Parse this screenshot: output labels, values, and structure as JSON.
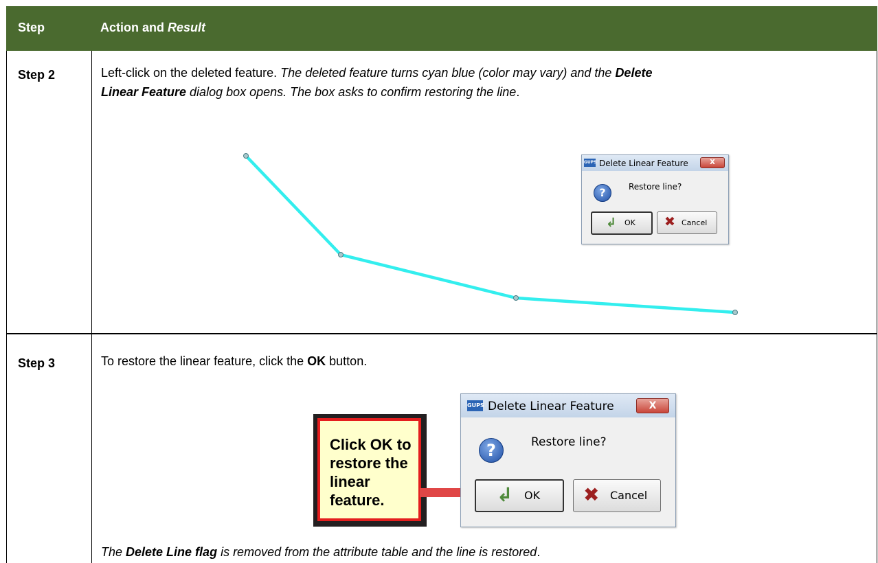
{
  "header": {
    "step": "Step",
    "action": "Action and ",
    "result": "Result"
  },
  "row1": {
    "step": "Step 2",
    "line1_plain": "Left-click on the deleted feature. ",
    "line1_it": "The deleted feature turns cyan blue (color may vary) and the ",
    "line1_bold": "Delete",
    "line2_bold": "Linear Feature",
    "line2_it": " dialog box opens. The box asks to confirm restoring the line",
    "line2_end": "."
  },
  "line_points": [
    [
      358,
      227
    ],
    [
      496,
      371
    ],
    [
      751,
      434
    ],
    [
      1070,
      455
    ]
  ],
  "line_color": "#33eeee",
  "dialog": {
    "title": "Delete Linear Feature",
    "logo": "GUPS",
    "close": "X",
    "icon": "?",
    "message": "Restore line?",
    "ok": "OK",
    "cancel": "Cancel"
  },
  "row2": {
    "step": "Step 3",
    "text_pre": "To restore the linear feature, click the ",
    "text_bold": "OK",
    "text_post": " button.",
    "callout": "Click OK to restore the linear feature.",
    "footer_it1": "The ",
    "footer_bold": "Delete Line flag",
    "footer_it2": " is removed from the attribute table and the line is restored",
    "footer_end": "."
  },
  "colors": {
    "header_bg": "#4a6a2f",
    "callout_border": "#e41e1e",
    "callout_bg": "#ffffcc",
    "arrow": "#e04646"
  }
}
